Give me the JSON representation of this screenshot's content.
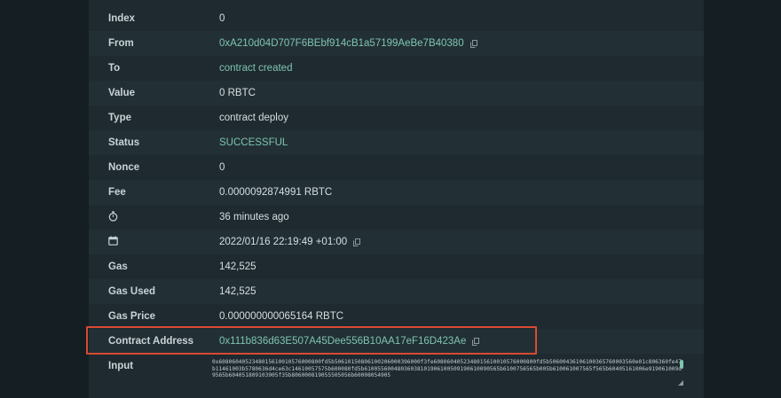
{
  "rows": [
    {
      "label": "Index",
      "value": "0"
    },
    {
      "label": "From",
      "value": "0xA210d04D707F6BEbf914cB1a57199AeBe7B40380"
    },
    {
      "label": "To",
      "value": "contract created"
    },
    {
      "label": "Value",
      "value": "0 RBTC"
    },
    {
      "label": "Type",
      "value": "contract deploy"
    },
    {
      "label": "Status",
      "value": "SUCCESSFUL"
    },
    {
      "label": "Nonce",
      "value": "0"
    },
    {
      "label": "Fee",
      "value": "0.0000092874991 RBTC"
    },
    {
      "label": "",
      "icon": "stopwatch-icon",
      "value": "36 minutes ago"
    },
    {
      "label": "",
      "icon": "calendar-icon",
      "value": "2022/01/16 22:19:49 +01:00"
    },
    {
      "label": "Gas",
      "value": "142,525"
    },
    {
      "label": "Gas Used",
      "value": "142,525"
    },
    {
      "label": "Gas Price",
      "value": "0.000000000065164 RBTC"
    },
    {
      "label": "Contract Address",
      "value": "0x111b836d63E507A45Dee556B10AA17eF16D423Ae"
    },
    {
      "label": "Input",
      "value": "0x6080604052348015610010576000800fd5b50610150806100206000396000f3fe6080604052348015610010576000800fd5b50600436106100365760003560e01c806360fe47b11461003b5780636d4ce63c14610057575b600080fd5b61005560048036038101906100509190610090565b6100756565b005b610061007565f565b60405161006e919061009d9565b604051809103905f35b806000819055505056b60008054905"
    }
  ],
  "colors": {
    "background": "#151e22",
    "panel": "#1e2a30",
    "accent": "#7fc4ae",
    "highlight": "#d94a32"
  }
}
